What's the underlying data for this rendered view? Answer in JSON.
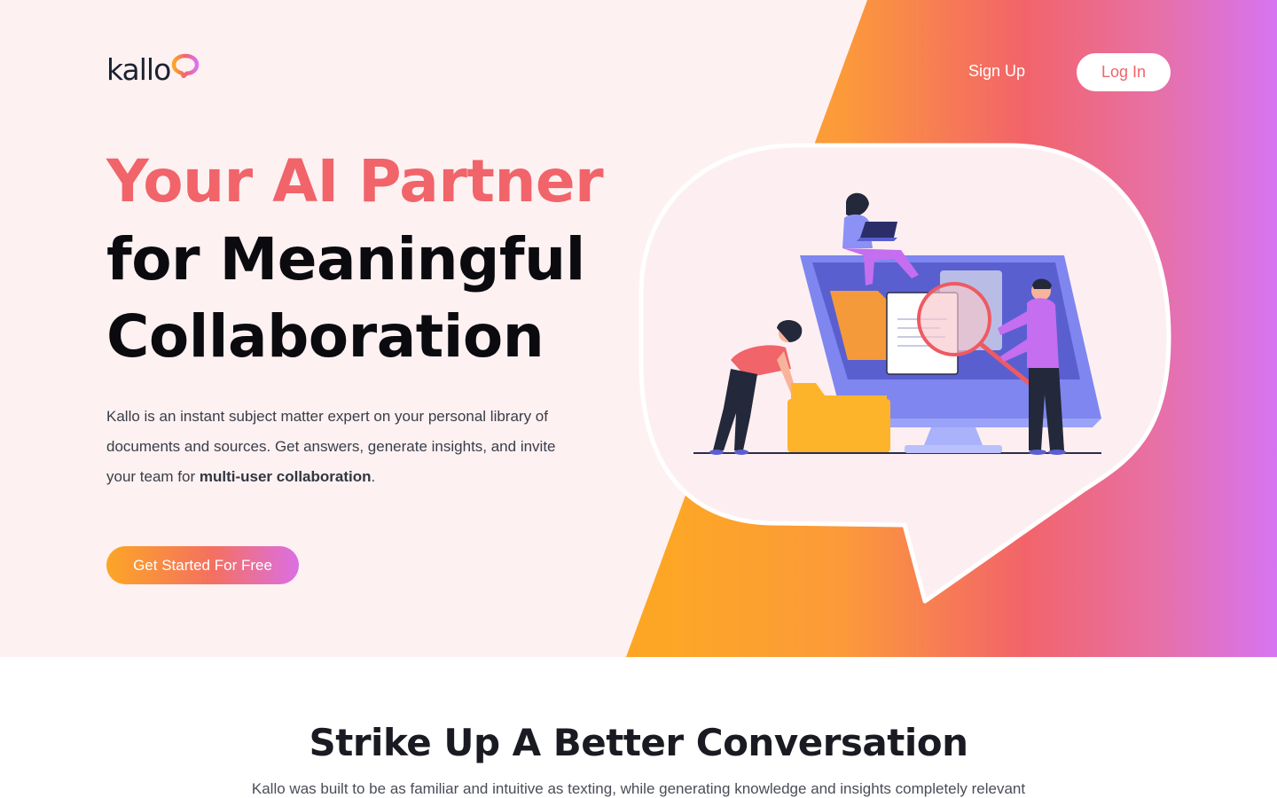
{
  "brand": {
    "logo_text": "kallo",
    "accent": "#f0646a",
    "gradient": [
      "#fda626",
      "#f47060",
      "#db6fe4"
    ]
  },
  "nav": {
    "signup_label": "Sign Up",
    "login_label": "Log In"
  },
  "hero": {
    "title_line_1": "Your AI Partner",
    "title_line_2": "for Meaningful",
    "title_line_3": "Collaboration",
    "description_prefix": "Kallo is an instant subject matter expert on your personal library of documents and sources. Get answers, generate insights, and invite your team for ",
    "description_bold": "multi-user collaboration",
    "description_suffix": ".",
    "cta_label": "Get Started For Free",
    "illustration": "team-collaborating-on-computer-illustration"
  },
  "section": {
    "title": "Strike Up A Better Conversation",
    "subtitle": "Kallo was built to be as familiar and intuitive as texting, while generating knowledge and insights completely relevant"
  }
}
